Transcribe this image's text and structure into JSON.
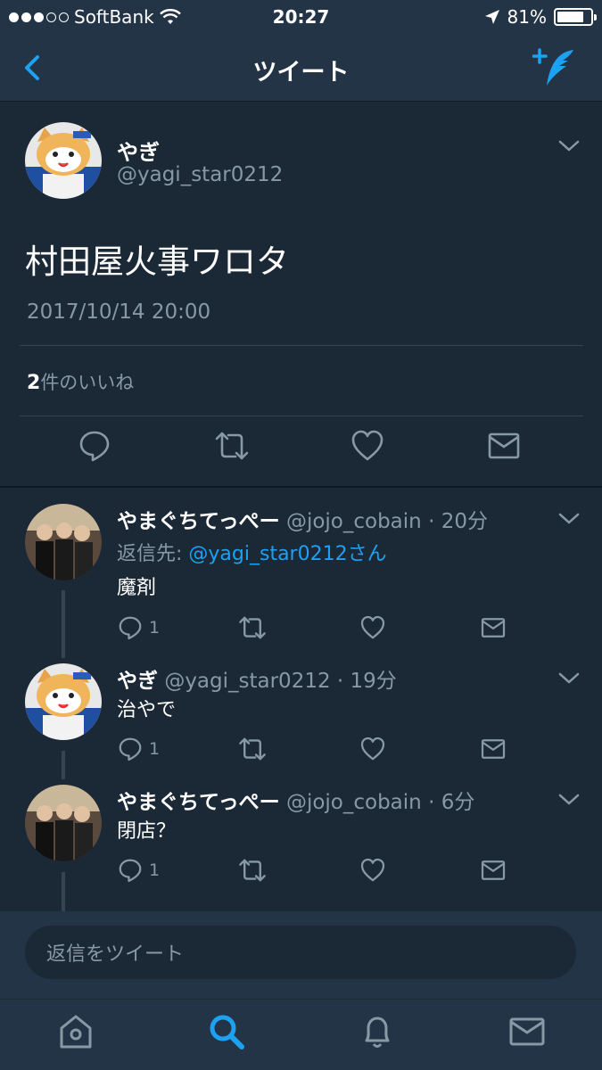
{
  "status_bar": {
    "carrier": "SoftBank",
    "time": "20:27",
    "battery": "81%",
    "battery_level": 0.81
  },
  "nav": {
    "title": "ツイート"
  },
  "main_tweet": {
    "name": "やぎ",
    "handle": "@yagi_star0212",
    "text": "村田屋火事ワロタ",
    "date": "2017/10/14 20:00",
    "likes_count": "2",
    "likes_label": "件のいいね"
  },
  "replies": [
    {
      "name": "やまぐちてっぺー",
      "handle": "@jojo_cobain",
      "sep": "·",
      "time": "20分",
      "reply_to_label": "返信先: ",
      "reply_to_mention": "@yagi_star0212さん",
      "text": "魔剤",
      "reply_count": "1"
    },
    {
      "name": "やぎ",
      "handle": "@yagi_star0212",
      "sep": "·",
      "time": "19分",
      "text": "治やで",
      "reply_count": "1"
    },
    {
      "name": "やまぐちてっぺー",
      "handle": "@jojo_cobain",
      "sep": "·",
      "time": "6分",
      "text": "閉店？",
      "reply_count": "1"
    }
  ],
  "composer": {
    "placeholder": "返信をツイート"
  },
  "icons": {
    "back": "chevron-left-icon",
    "compose": "compose-tweet-icon",
    "reply": "reply-icon",
    "retweet": "retweet-icon",
    "like": "heart-icon",
    "dm": "envelope-icon",
    "home": "home-icon",
    "search": "search-icon",
    "notifications": "bell-icon",
    "messages": "envelope-icon"
  },
  "colors": {
    "background": "#1b2836",
    "bar": "#243447",
    "accent": "#1da1f2",
    "secondary_text": "#8899a6"
  }
}
